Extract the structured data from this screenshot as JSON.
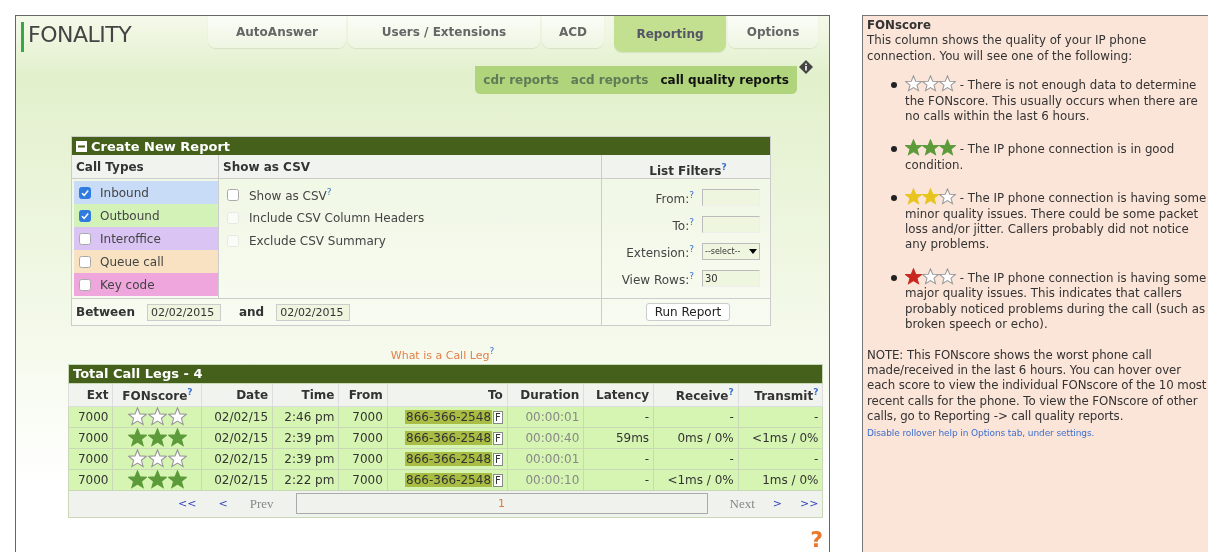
{
  "logo": "FONALITY",
  "tabs": [
    {
      "label": "AutoAnswer",
      "selected": false
    },
    {
      "label": "Users / Extensions",
      "selected": false
    },
    {
      "label": "ACD",
      "selected": false
    },
    {
      "label": "Reporting",
      "selected": true
    },
    {
      "label": "Options",
      "selected": false
    }
  ],
  "subtabs": [
    {
      "label": "cdr reports",
      "selected": false
    },
    {
      "label": "acd reports",
      "selected": false
    },
    {
      "label": "call quality reports",
      "selected": true
    }
  ],
  "report_form": {
    "title": "Create New Report",
    "call_types_heading": "Call Types",
    "csv_heading": "Show as CSV",
    "filters_heading": "List Filters$^{?}$",
    "call_types": [
      {
        "label": "Inbound",
        "checked": true,
        "color": "#c8dcf8"
      },
      {
        "label": "Outbound",
        "checked": true,
        "color": "#d3f2b8"
      },
      {
        "label": "Interoffice",
        "checked": false,
        "color": "#d9c4f4"
      },
      {
        "label": "Queue call",
        "checked": false,
        "color": "#f8e2c2"
      },
      {
        "label": "Key code",
        "checked": false,
        "color": "#eea6dc"
      }
    ],
    "csv_options": [
      {
        "label": "Show as CSV$^{?}$",
        "checked": false,
        "disabled": false
      },
      {
        "label": "Include CSV Column Headers",
        "checked": false,
        "disabled": true
      },
      {
        "label": "Exclude CSV Summary",
        "checked": false,
        "disabled": true
      }
    ],
    "filters": [
      {
        "kind": "text",
        "label": "From:$^{?}$"
      },
      {
        "kind": "text",
        "label": "To:$^{?}$"
      },
      {
        "kind": "select",
        "label": "Extension:$^{?}$",
        "value": "--select--"
      },
      {
        "kind": "text",
        "label": "View Rows:$^{?}$",
        "value": "30"
      }
    ],
    "between_label": "Between",
    "date_from": "02/02/2015",
    "and_label": "and",
    "date_to": "02/02/2015",
    "run_button": "Run Report"
  },
  "call_leg_link": "What is a Call Leg$^{?}$",
  "calls_table": {
    "title": "Total Call Legs - 4",
    "columns": [
      "Ext",
      "FONscore$^{?}$",
      "Date",
      "Time",
      "From",
      "To",
      "Duration",
      "Latency",
      "Receive$^{?}$",
      "Transmit$^{?}$"
    ],
    "rows": [
      {
        "ext": "7000",
        "stars": 0,
        "date": "02/02/15",
        "time": "2:46 pm",
        "from": "7000",
        "to": "866-366-2548",
        "to_flag": "F",
        "duration": "00:00:01",
        "latency": "-",
        "receive": "-",
        "transmit": "-"
      },
      {
        "ext": "7000",
        "stars": 3,
        "date": "02/02/15",
        "time": "2:39 pm",
        "from": "7000",
        "to": "866-366-2548",
        "to_flag": "F",
        "duration": "00:00:40",
        "latency": "59ms",
        "receive": "0ms / 0%",
        "transmit": "<1ms / 0%"
      },
      {
        "ext": "7000",
        "stars": 0,
        "date": "02/02/15",
        "time": "2:39 pm",
        "from": "7000",
        "to": "866-366-2548",
        "to_flag": "F",
        "duration": "00:00:01",
        "latency": "-",
        "receive": "-",
        "transmit": "-"
      },
      {
        "ext": "7000",
        "stars": 3,
        "date": "02/02/15",
        "time": "2:22 pm",
        "from": "7000",
        "to": "866-366-2548",
        "to_flag": "F",
        "duration": "00:00:10",
        "latency": "-",
        "receive": "<1ms / 0%",
        "transmit": "1ms / 0%"
      }
    ],
    "pager": {
      "first": "<<",
      "prev_arrow": "<",
      "prev": "Prev",
      "page": "1",
      "next": "Next",
      "next_arrow": ">",
      "last": ">>"
    }
  },
  "corner_help": "?",
  "help_panel": {
    "title": "FONscore",
    "intro": "This column shows the quality of your IP phone connection. You will see one of the following:",
    "legend": [
      {
        "stars": 0,
        "text": "- There is not enough data to determine the FONscore. This usually occurs when there are no calls within the last 6 hours."
      },
      {
        "stars": 3,
        "color": "#5c9a3a",
        "text": "- The IP phone connection is in good condition."
      },
      {
        "stars": 2,
        "color": "#e8c41e",
        "text": "- The IP phone connection is having some minor quality issues. There could be some packet loss and/or jitter. Callers probably did not notice any problems."
      },
      {
        "stars": 1,
        "color": "#c8261e",
        "text": "- The IP phone connection is having some major quality issues. This indicates that callers probably noticed problems during the call (such as broken speech or echo)."
      }
    ],
    "note": "NOTE: This FONscore shows the worst phone call made/received in the last 6 hours. You can hover over each score to view the individual FONscore of the 10 most recent calls for the phone. To view the FONscore of other calls, go to Reporting -> call quality reports.",
    "note_link": "Disable rollover help in Options tab, under settings."
  }
}
